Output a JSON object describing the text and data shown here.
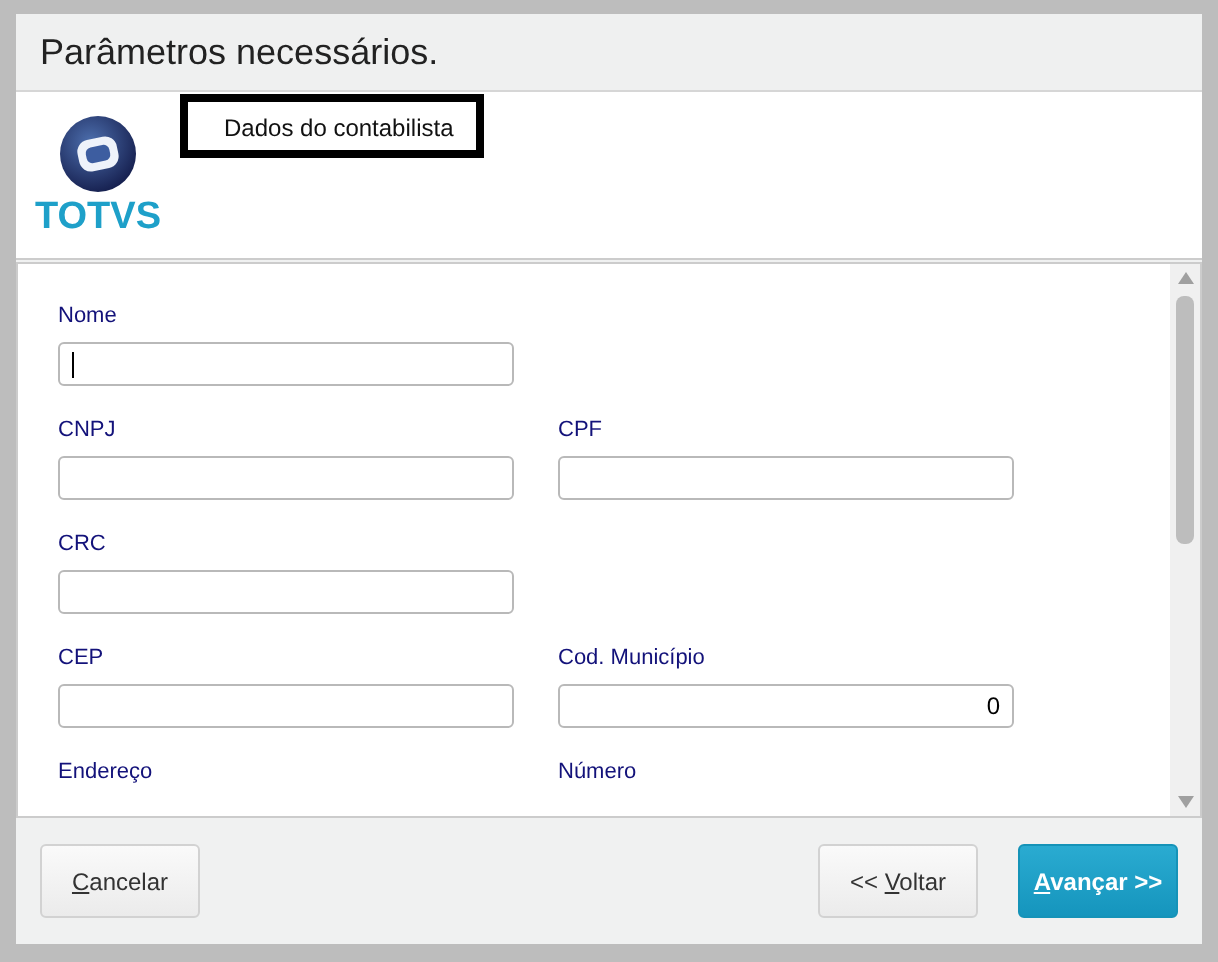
{
  "window": {
    "title": "Parâmetros necessários."
  },
  "header": {
    "logo_text": "TOTVS",
    "section_title": "Dados do contabilista"
  },
  "form": {
    "rows": [
      [
        {
          "kind": "field",
          "label": "Nome",
          "focused": true
        }
      ],
      [
        {
          "kind": "field",
          "label": "CNPJ",
          "focused": false
        },
        {
          "kind": "field",
          "label": "CPF",
          "focused": false
        }
      ],
      [
        {
          "kind": "field",
          "label": "CRC",
          "focused": false
        }
      ],
      [
        {
          "kind": "field",
          "label": "CEP",
          "focused": false
        },
        {
          "kind": "number",
          "label": "Cod. Município",
          "value": "0",
          "focused": false
        }
      ],
      [
        {
          "kind": "label",
          "label": "Endereço"
        },
        {
          "kind": "label",
          "label": "Número"
        }
      ]
    ]
  },
  "buttons": [
    {
      "kind": "default",
      "key": "C",
      "after": "ancelar"
    },
    {
      "kind": "default",
      "before": "<< ",
      "key": "V",
      "after": "oltar"
    },
    {
      "kind": "primary",
      "key": "A",
      "after": "vançar >>"
    }
  ]
}
